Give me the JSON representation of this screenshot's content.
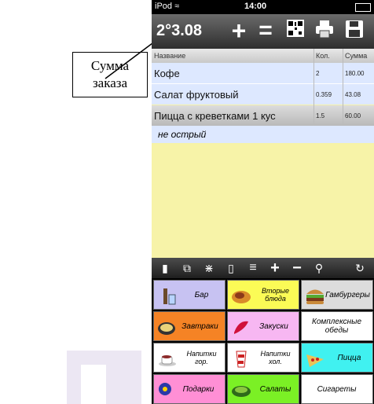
{
  "callout": {
    "text": "Сумма заказа"
  },
  "status_bar": {
    "carrier": "iPod",
    "time": "14:00"
  },
  "toolbar": {
    "total": "2°3.08"
  },
  "order": {
    "columns": [
      "Название",
      "Кол.",
      "Сумма"
    ],
    "rows": [
      {
        "name": "Кофе",
        "qty": "2",
        "sum": "180.00"
      },
      {
        "name": "Салат фруктовый",
        "qty": "0.359",
        "sum": "43.08"
      },
      {
        "name": "Пицца с креветками 1 кус",
        "qty": "1.5",
        "sum": "60.00"
      }
    ],
    "modifier": "не острый"
  },
  "categories": [
    {
      "label": "Бар",
      "color": "#c7c2f2",
      "icon": "bottle-icon"
    },
    {
      "label": "Вторые блюда",
      "color": "#fbfb56",
      "icon": "dish-icon"
    },
    {
      "label": "Гамбургеры",
      "color": "#dcdcdc",
      "icon": "burger-icon"
    },
    {
      "label": "Завтраки",
      "color": "#f58325",
      "icon": "pan-icon"
    },
    {
      "label": "Закуски",
      "color": "#f7b7f2",
      "icon": "pepper-icon"
    },
    {
      "label": "Комплексные обеды",
      "color": "#ffffff",
      "icon": "none"
    },
    {
      "label": "Напитки гор.",
      "color": "#ffffff",
      "icon": "coffee-cup-icon"
    },
    {
      "label": "Напитки хол.",
      "color": "#ffffff",
      "icon": "soda-cup-icon"
    },
    {
      "label": "Пицца",
      "color": "#40f1f0",
      "icon": "pizza-icon"
    },
    {
      "label": "Подарки",
      "color": "#ff8fd5",
      "icon": "gift-icon"
    },
    {
      "label": "Салаты",
      "color": "#7bf025",
      "icon": "salad-icon"
    },
    {
      "label": "Сигареты",
      "color": "#ffffff",
      "icon": "none"
    }
  ]
}
